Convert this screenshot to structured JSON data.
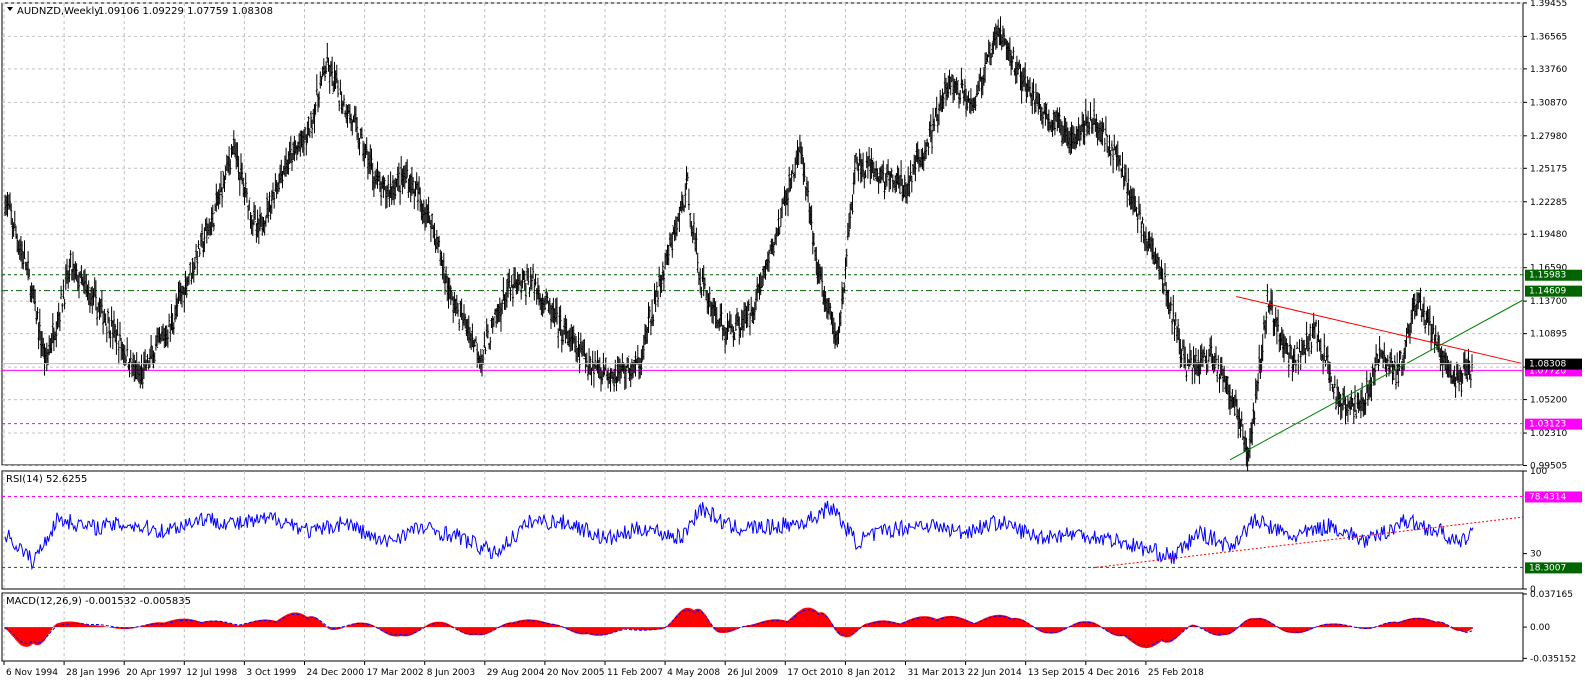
{
  "header": {
    "symbol_title": "AUDNZD,Weekly",
    "ohlc": "1.09106 1.09229 1.07759 1.08308"
  },
  "colors": {
    "price": "#000000",
    "grid": "#c0c0c0",
    "resistance_line": "#ff0000",
    "support_line": "#008000",
    "green_levels": "#006400",
    "magenta_levels": "#ff00ff",
    "rsi_line": "#0000ff",
    "macd_hist": "#ff0000",
    "macd_signal": "#0000ff"
  },
  "chart_data": [
    {
      "type": "line",
      "name": "price",
      "ylim": [
        0.9955,
        1.3945
      ],
      "y_ticks": [
        "1.39455",
        "1.36565",
        "1.33760",
        "1.30870",
        "1.27980",
        "1.25175",
        "1.22285",
        "1.19480",
        "1.16590",
        "1.13700",
        "1.10895",
        "1.08005",
        "1.05200",
        "1.02310",
        "0.99505"
      ],
      "x_ticks": [
        "6 Nov 1994",
        "28 Jan 1996",
        "20 Apr 1997",
        "12 Jul 1998",
        "3 Oct 1999",
        "24 Dec 2000",
        "17 Mar 2002",
        "8 Jun 2003",
        "29 Aug 2004",
        "20 Nov 2005",
        "11 Feb 2007",
        "4 May 2008",
        "26 Jul 2009",
        "17 Oct 2010",
        "8 Jan 2012",
        "31 Mar 2013",
        "22 Jun 2014",
        "13 Sep 2015",
        "4 Dec 2016",
        "25 Feb 2018"
      ],
      "x": [
        1994.85,
        1995.2,
        1995.5,
        1995.9,
        1996.5,
        1997.0,
        1997.5,
        1997.8,
        1998.2,
        1998.5,
        1998.9,
        1999.3,
        1999.7,
        2000.0,
        2000.4,
        2000.9,
        2001.3,
        2001.7,
        2002.0,
        2002.5,
        2002.9,
        2003.3,
        2003.8,
        2004.2,
        2004.6,
        2005.0,
        2005.4,
        2005.8,
        2006.0,
        2006.4,
        2006.8,
        2007.2,
        2007.6,
        2007.9,
        2008.2,
        2008.5,
        2008.9,
        2009.3,
        2009.7,
        2010.0,
        2010.4,
        2010.8,
        2011.1,
        2011.5,
        2011.9,
        2012.3,
        2012.7,
        2013.0,
        2013.4,
        2013.8,
        2014.2,
        2014.5,
        2014.8,
        2015.1,
        2015.5,
        2015.9,
        2016.2,
        2016.6,
        2016.9,
        2017.2,
        2017.5,
        2017.8,
        2018.1,
        2018.4
      ],
      "close": [
        1.225,
        1.165,
        1.085,
        1.165,
        1.12,
        1.07,
        1.115,
        1.16,
        1.21,
        1.27,
        1.195,
        1.25,
        1.28,
        1.34,
        1.295,
        1.23,
        1.245,
        1.205,
        1.14,
        1.09,
        1.145,
        1.155,
        1.11,
        1.085,
        1.075,
        1.08,
        1.16,
        1.235,
        1.155,
        1.11,
        1.125,
        1.19,
        1.27,
        1.16,
        1.1,
        1.255,
        1.245,
        1.235,
        1.28,
        1.325,
        1.31,
        1.37,
        1.335,
        1.3,
        1.28,
        1.295,
        1.26,
        1.215,
        1.16,
        1.08,
        1.09,
        1.06,
        1.005,
        1.135,
        1.085,
        1.11,
        1.055,
        1.045,
        1.09,
        1.075,
        1.135,
        1.105,
        1.065,
        1.083
      ],
      "levels": [
        {
          "label": "1.15983",
          "value": 1.15983,
          "style": "green-dashed"
        },
        {
          "label": "1.14609",
          "value": 1.14609,
          "style": "green-dashdot"
        },
        {
          "label": "1.07720",
          "value": 1.0772,
          "style": "magenta-solid"
        },
        {
          "label": "1.03123",
          "value": 1.03123,
          "style": "magenta-dashed"
        }
      ],
      "current_price_tag": "1.08308",
      "resistance": {
        "x": [
          2014.6,
          2019.2
        ],
        "y": [
          1.141,
          1.083
        ]
      },
      "support": {
        "x": [
          2014.5,
          2019.2
        ],
        "y": [
          1.0,
          1.138
        ]
      }
    },
    {
      "type": "line",
      "name": "RSI",
      "label": "RSI(14) 52.6255",
      "ylim": [
        0,
        100
      ],
      "y_ticks": [
        "100",
        "30",
        "0"
      ],
      "levels": [
        {
          "label": "78.4314",
          "value": 78.4314
        },
        {
          "label": "18.3007",
          "value": 18.3007
        }
      ],
      "x": [
        1994.85,
        1995.3,
        1995.7,
        1996.2,
        1996.8,
        1997.4,
        1998.0,
        1998.6,
        1999.2,
        1999.8,
        2000.3,
        2000.9,
        2001.5,
        2002.1,
        2002.7,
        2003.3,
        2003.9,
        2004.5,
        2005.1,
        2005.7,
        2006.0,
        2006.5,
        2007.1,
        2007.7,
        2008.1,
        2008.5,
        2009.0,
        2009.6,
        2010.2,
        2010.8,
        2011.4,
        2012.0,
        2012.6,
        2013.2,
        2013.6,
        2014.0,
        2014.5,
        2014.9,
        2015.5,
        2016.1,
        2016.7,
        2017.3,
        2017.9,
        2018.2,
        2018.4
      ],
      "values": [
        47,
        23,
        60,
        52,
        55,
        49,
        60,
        55,
        60,
        48,
        57,
        39,
        52,
        45,
        30,
        58,
        56,
        42,
        52,
        43,
        69,
        52,
        52,
        57,
        70,
        40,
        50,
        55,
        48,
        57,
        44,
        47,
        42,
        33,
        27,
        48,
        36,
        58,
        44,
        54,
        40,
        58,
        48,
        37,
        52
      ],
      "trendline": {
        "x": [
          2012.3,
          2019.2
        ],
        "y": [
          18,
          61
        ]
      }
    },
    {
      "type": "bar",
      "name": "MACD",
      "label": "MACD(12,26,9) -0.001532 -0.005835",
      "ylim": [
        -0.0381,
        0.0383
      ],
      "y_ticks": [
        "0.037165",
        "0.00",
        "-0.035152"
      ],
      "x": [
        1994.85,
        1995.3,
        1995.7,
        1996.2,
        1996.8,
        1997.4,
        1998.0,
        1998.6,
        1999.2,
        1999.7,
        2000.1,
        2000.6,
        2001.2,
        2001.8,
        2002.4,
        2003.0,
        2003.6,
        2004.2,
        2004.8,
        2005.4,
        2005.9,
        2006.3,
        2006.8,
        2007.4,
        2007.9,
        2008.3,
        2008.7,
        2009.2,
        2009.8,
        2010.4,
        2011.0,
        2011.6,
        2012.2,
        2012.8,
        2013.4,
        2013.9,
        2014.4,
        2014.9,
        2015.5,
        2016.1,
        2016.7,
        2017.2,
        2017.8,
        2018.2,
        2018.4
      ],
      "values": [
        -0.003,
        -0.033,
        0.008,
        0.004,
        -0.004,
        0.009,
        0.01,
        0.003,
        0.012,
        0.02,
        -0.006,
        0.009,
        -0.018,
        0.011,
        -0.016,
        0.01,
        0.007,
        -0.014,
        -0.003,
        -0.004,
        0.034,
        -0.011,
        0.004,
        0.012,
        0.029,
        -0.019,
        0.008,
        0.007,
        0.016,
        0.008,
        0.018,
        -0.013,
        0.012,
        -0.018,
        -0.028,
        0.005,
        -0.016,
        0.018,
        -0.012,
        0.007,
        -0.004,
        0.01,
        0.011,
        -0.008,
        -0.002
      ],
      "signal": [
        -0.001,
        -0.028,
        0.003,
        0.005,
        -0.002,
        0.006,
        0.009,
        0.004,
        0.01,
        0.018,
        -0.003,
        0.007,
        -0.015,
        0.008,
        -0.014,
        0.008,
        0.006,
        -0.012,
        -0.004,
        -0.003,
        0.03,
        -0.008,
        0.003,
        0.01,
        0.026,
        -0.016,
        0.006,
        0.006,
        0.014,
        0.007,
        0.016,
        -0.011,
        0.01,
        -0.016,
        -0.025,
        0.003,
        -0.014,
        0.016,
        -0.01,
        0.006,
        -0.003,
        0.009,
        0.01,
        -0.006,
        -0.006
      ]
    }
  ]
}
